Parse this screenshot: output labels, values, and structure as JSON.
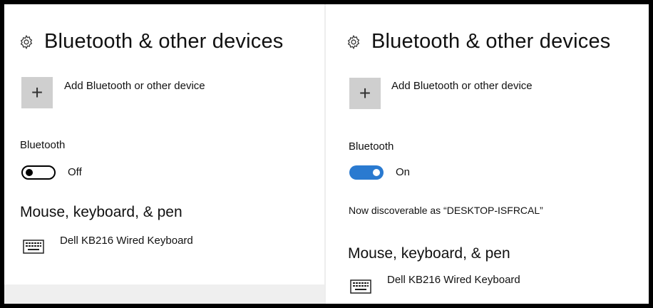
{
  "left": {
    "header": {
      "icon": "gear-icon",
      "title": "Bluetooth & other devices"
    },
    "add_device": {
      "icon": "plus-icon",
      "plus_glyph": "+",
      "label": "Add Bluetooth or other device"
    },
    "bluetooth": {
      "label": "Bluetooth",
      "toggle_on": false,
      "state": "Off"
    },
    "mouse_keyboard_pen": {
      "title": "Mouse, keyboard, & pen",
      "devices": [
        {
          "icon": "keyboard-icon",
          "name": "Dell KB216 Wired Keyboard"
        }
      ]
    }
  },
  "right": {
    "header": {
      "icon": "gear-icon",
      "title": "Bluetooth & other devices"
    },
    "add_device": {
      "icon": "plus-icon",
      "plus_glyph": "+",
      "label": "Add Bluetooth or other device"
    },
    "bluetooth": {
      "label": "Bluetooth",
      "toggle_on": true,
      "state": "On"
    },
    "discoverable_text": "Now discoverable as “DESKTOP-ISFRCAL”",
    "mouse_keyboard_pen": {
      "title": "Mouse, keyboard, & pen",
      "devices": [
        {
          "icon": "keyboard-icon",
          "name": "Dell KB216 Wired Keyboard"
        }
      ]
    }
  },
  "colors": {
    "toggle_on": "#2a7ad0",
    "add_button_bg": "#cfcfcf",
    "border": "#000000"
  }
}
